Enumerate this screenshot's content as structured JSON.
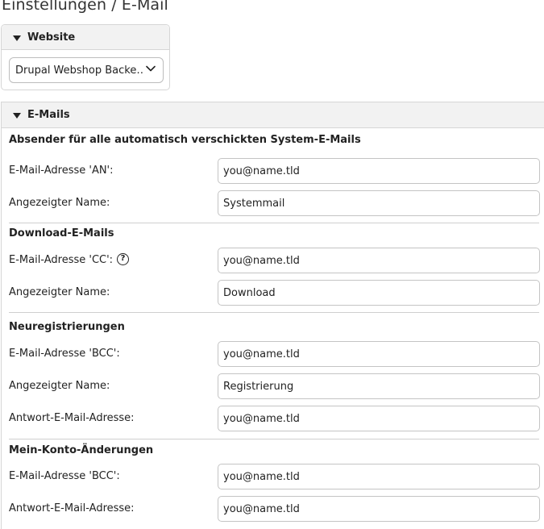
{
  "page": {
    "title": "Einstellungen / E-Mail"
  },
  "website_panel": {
    "label": "Website",
    "select_value": "Drupal Webshop Backe…"
  },
  "emails_panel": {
    "label": "E-Mails",
    "sections": [
      {
        "title": "Absender für alle automatisch verschickten System-E-Mails",
        "fields": [
          {
            "label": "E-Mail-Adresse 'AN':",
            "value": "you@name.tld"
          },
          {
            "label": "Angezeigter Name:",
            "value": "Systemmail"
          }
        ]
      },
      {
        "title": "Download-E-Mails",
        "fields": [
          {
            "label": "E-Mail-Adresse 'CC':",
            "value": "you@name.tld",
            "help_icon": "?"
          },
          {
            "label": "Angezeigter Name:",
            "value": "Download"
          }
        ]
      },
      {
        "title": "Neuregistrierungen",
        "fields": [
          {
            "label": "E-Mail-Adresse 'BCC':",
            "value": "you@name.tld"
          },
          {
            "label": "Angezeigter Name:",
            "value": "Registrierung"
          },
          {
            "label": "Antwort-E-Mail-Adresse:",
            "value": "you@name.tld"
          }
        ]
      },
      {
        "title": "Mein-Konto-Änderungen",
        "fields": [
          {
            "label": "E-Mail-Adresse 'BCC':",
            "value": "you@name.tld"
          },
          {
            "label": "Antwort-E-Mail-Adresse:",
            "value": "you@name.tld"
          }
        ]
      }
    ]
  }
}
